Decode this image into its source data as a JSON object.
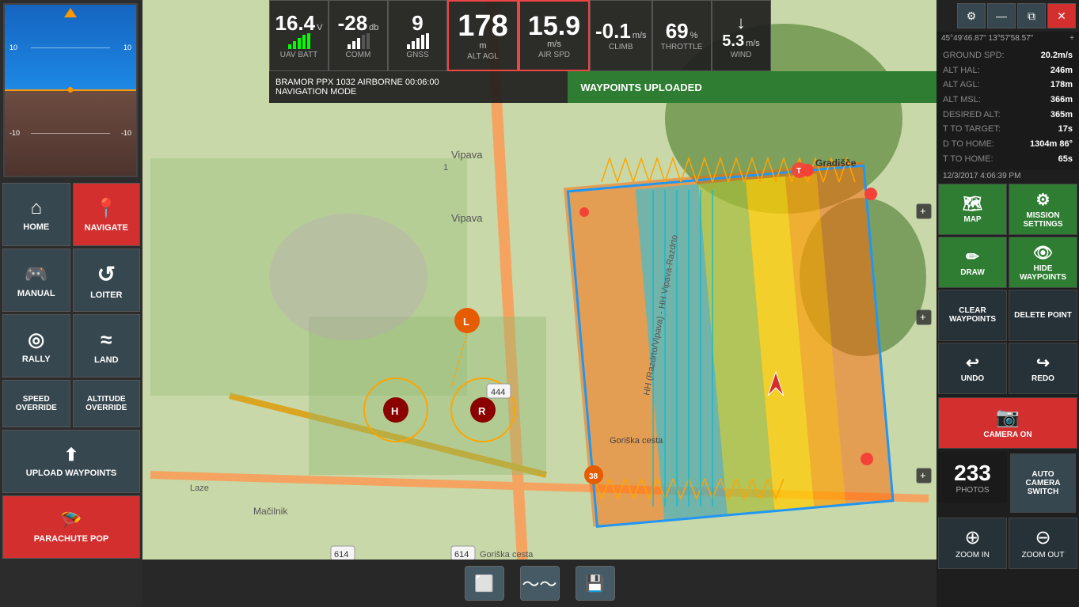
{
  "top_hud": {
    "uav_batt": {
      "value": "16.4",
      "unit": "V",
      "label": "UAV BATT"
    },
    "comm": {
      "value": "-28",
      "unit": "db",
      "label": "COMM"
    },
    "gnss": {
      "value": "9",
      "unit": "",
      "label": "GNSS"
    },
    "alt_agl": {
      "value": "178",
      "unit": "m",
      "label": "ALT AGL"
    },
    "air_spd": {
      "value": "15.9",
      "unit": "m/s",
      "label": "AIR SPD"
    },
    "climb": {
      "value": "-0.1",
      "unit": "m/s",
      "label": "CLIMB"
    },
    "throttle": {
      "value": "69",
      "unit": "%",
      "label": "THROTTLE"
    },
    "wind": {
      "value": "5.3",
      "unit": "m/s",
      "label": "WIND"
    }
  },
  "status_bar": {
    "mission": "BRAMOR PPX 1032 AIRBORNE 00:06:00",
    "mode": "NAVIGATION MODE",
    "waypoints": "WAYPOINTS UPLOADED"
  },
  "nav_buttons": [
    {
      "id": "home",
      "label": "HOME",
      "icon": "⌂",
      "active": false
    },
    {
      "id": "navigate",
      "label": "NAVIGATE",
      "icon": "📍",
      "active": true
    },
    {
      "id": "manual",
      "label": "MANUAL",
      "icon": "🎮",
      "active": false
    },
    {
      "id": "loiter",
      "label": "LOITER",
      "icon": "↺",
      "active": false
    },
    {
      "id": "rally",
      "label": "RALLY",
      "icon": "◎",
      "active": false
    },
    {
      "id": "land",
      "label": "LAND",
      "icon": "≈",
      "active": false
    },
    {
      "id": "speed_override",
      "label": "SPEED OVERRIDE",
      "icon": "",
      "active": false
    },
    {
      "id": "altitude_override",
      "label": "ALTITUDE OVERRIDE",
      "icon": "",
      "active": false
    },
    {
      "id": "upload_waypoints",
      "label": "UPLOAD WAYPOINTS",
      "icon": "⬆",
      "active": false
    },
    {
      "id": "parachute_pop",
      "label": "PARACHUTE POP",
      "icon": "🪂",
      "active": false,
      "red": true
    }
  ],
  "bottom_tools": [
    {
      "id": "rectangle",
      "icon": "⬜"
    },
    {
      "id": "wave",
      "icon": "〜"
    },
    {
      "id": "save",
      "icon": "💾"
    }
  ],
  "right_panel": {
    "top_buttons": [
      {
        "id": "settings",
        "icon": "⚙"
      },
      {
        "id": "minimize",
        "icon": "—"
      },
      {
        "id": "tile",
        "icon": "⧉"
      },
      {
        "id": "close",
        "icon": "✕",
        "red": true
      }
    ],
    "coords": "45°49'46.87\"  13°57'58.57\"",
    "telemetry": {
      "ground_spd": {
        "label": "GROUND SPD:",
        "value": "20.2m/s"
      },
      "alt_hal": {
        "label": "ALT HAL:",
        "value": "246m"
      },
      "alt_agl": {
        "label": "ALT AGL:",
        "value": "178m"
      },
      "alt_msl": {
        "label": "ALT MSL:",
        "value": "366m"
      },
      "desired_alt": {
        "label": "DESIRED ALT:",
        "value": "365m"
      },
      "t_to_target": {
        "label": "T TO TARGET:",
        "value": "17s"
      },
      "d_to_home": {
        "label": "D TO HOME:",
        "value": "1304m 86°"
      },
      "t_to_home": {
        "label": "T TO HOME:",
        "value": "65s"
      }
    },
    "datetime": "12/3/2017 4:06:39 PM",
    "map_buttons": [
      {
        "id": "map",
        "label": "MAP",
        "icon": "🗺",
        "style": "green"
      },
      {
        "id": "mission_settings",
        "label": "MISSION SETTINGS",
        "icon": "⚙",
        "style": "green"
      },
      {
        "id": "draw",
        "label": "DRAW",
        "icon": "✏",
        "style": "green"
      },
      {
        "id": "hide_waypoints",
        "label": "HIDE WAYPOINTS",
        "icon": "👁",
        "style": "green"
      },
      {
        "id": "clear_waypoints",
        "label": "CLEAR WAYPOINTS",
        "icon": "",
        "style": "dark"
      },
      {
        "id": "delete_point",
        "label": "DELETE POINT",
        "icon": "",
        "style": "dark"
      },
      {
        "id": "undo",
        "label": "UNDO",
        "icon": "↩",
        "style": "dark"
      },
      {
        "id": "redo",
        "label": "REDO",
        "icon": "↪",
        "style": "dark"
      }
    ],
    "camera": {
      "label": "CAMERA ON",
      "icon": "📷"
    },
    "photos": {
      "count": "233",
      "label": "PHOTOS"
    },
    "auto_camera_switch": "AUTO CAMERA SWITCH",
    "zoom_in": "ZOOM IN",
    "zoom_out": "ZOOM OUT"
  }
}
